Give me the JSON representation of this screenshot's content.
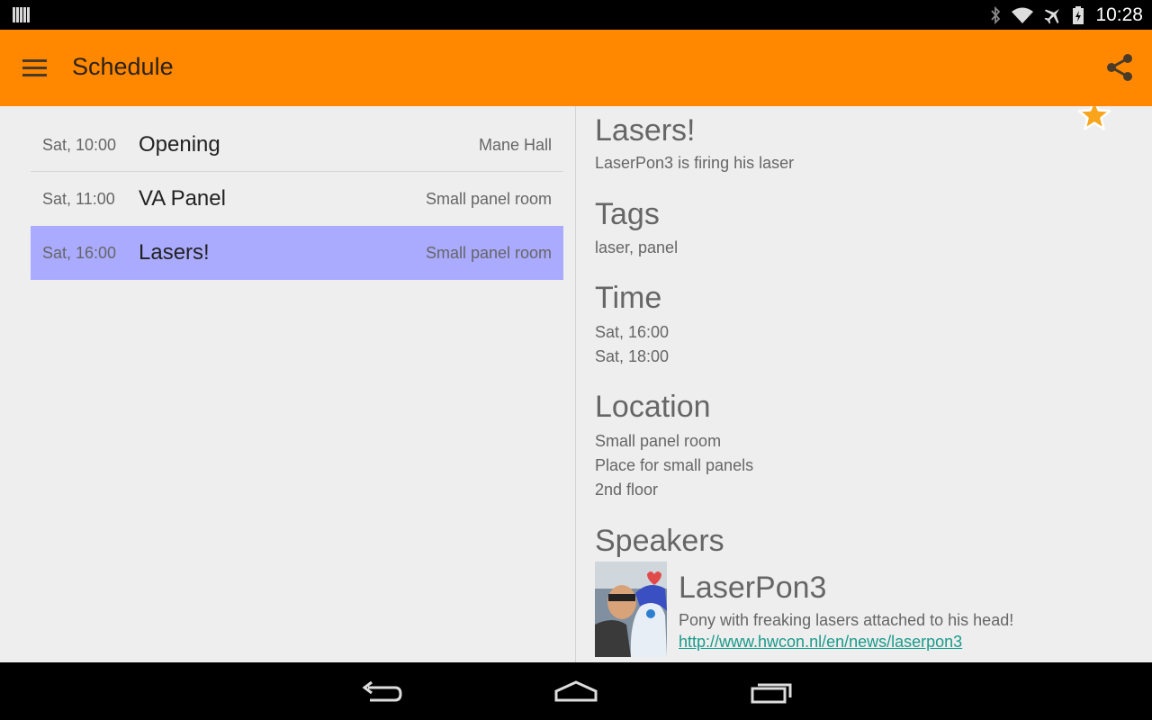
{
  "status_bar": {
    "time": "10:28",
    "icons": [
      "notification-icon",
      "bluetooth-icon",
      "wifi-icon",
      "airplane-icon",
      "battery-icon"
    ]
  },
  "app_bar": {
    "title": "Schedule",
    "menu_icon": "menu-icon",
    "share_icon": "share-icon",
    "color": "#ff8800"
  },
  "schedule": {
    "items": [
      {
        "time": "Sat, 10:00",
        "title": "Opening",
        "location": "Mane Hall",
        "selected": false
      },
      {
        "time": "Sat, 11:00",
        "title": "VA Panel",
        "location": "Small panel room",
        "selected": false
      },
      {
        "time": "Sat, 16:00",
        "title": "Lasers!",
        "location": "Small panel room",
        "selected": true
      }
    ],
    "selected_color": "#aaaaff"
  },
  "detail": {
    "title": "Lasers!",
    "description": "LaserPon3 is firing his laser",
    "favorite_icon": "star-icon",
    "tags_heading": "Tags",
    "tags": "laser, panel",
    "time_heading": "Time",
    "start": "Sat, 16:00",
    "end": "Sat, 18:00",
    "location_heading": "Location",
    "location_name": "Small panel room",
    "location_desc": "Place for small panels",
    "location_floor": "2nd floor",
    "speakers_heading": "Speakers",
    "speaker": {
      "name": "LaserPon3",
      "bio": "Pony with freaking lasers attached to his head!",
      "link": "http://www.hwcon.nl/en/news/laserpon3",
      "link_color": "#1a9a8a"
    }
  },
  "nav_bar": {
    "buttons": [
      "back-icon",
      "home-icon",
      "recents-icon"
    ]
  }
}
